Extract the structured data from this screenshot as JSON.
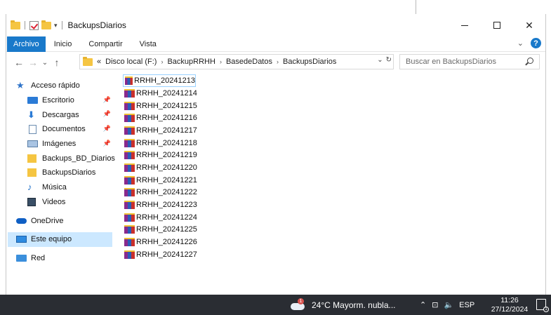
{
  "window": {
    "title": "BackupsDiarios"
  },
  "ribbon": {
    "tabs": [
      {
        "label": "Archivo",
        "active": true
      },
      {
        "label": "Inicio",
        "active": false
      },
      {
        "label": "Compartir",
        "active": false
      },
      {
        "label": "Vista",
        "active": false
      }
    ],
    "help_label": "?"
  },
  "address": {
    "overflow": "«",
    "crumbs": [
      "Disco local (F:)",
      "BackupRRHH",
      "BasedeDatos",
      "BackupsDiarios"
    ]
  },
  "search": {
    "placeholder": "Buscar en BackupsDiarios"
  },
  "sidebar": {
    "items": [
      {
        "label": "Acceso rápido",
        "icon": "star-icon",
        "pinned": false
      },
      {
        "label": "Escritorio",
        "icon": "desktop-icon",
        "pinned": true
      },
      {
        "label": "Descargas",
        "icon": "download-icon",
        "pinned": true
      },
      {
        "label": "Documentos",
        "icon": "documents-icon",
        "pinned": true
      },
      {
        "label": "Imágenes",
        "icon": "pictures-icon",
        "pinned": true
      },
      {
        "label": "Backups_BD_Diarios",
        "icon": "folder-icon",
        "pinned": false
      },
      {
        "label": "BackupsDiarios",
        "icon": "folder-icon",
        "pinned": false
      },
      {
        "label": "Música",
        "icon": "music-icon",
        "pinned": false
      },
      {
        "label": "Videos",
        "icon": "videos-icon",
        "pinned": false
      },
      {
        "label": "OneDrive",
        "icon": "onedrive-icon",
        "pinned": false
      },
      {
        "label": "Este equipo",
        "icon": "this-pc-icon",
        "pinned": false
      },
      {
        "label": "Red",
        "icon": "network-icon",
        "pinned": false
      }
    ]
  },
  "files": [
    "RRHH_20241213",
    "RRHH_20241214",
    "RRHH_20241215",
    "RRHH_20241216",
    "RRHH_20241217",
    "RRHH_20241218",
    "RRHH_20241219",
    "RRHH_20241220",
    "RRHH_20241221",
    "RRHH_20241222",
    "RRHH_20241223",
    "RRHH_20241224",
    "RRHH_20241225",
    "RRHH_20241226",
    "RRHH_20241227"
  ],
  "taskbar": {
    "weather": "24°C  Mayorm. nubla...",
    "weather_badge": "1",
    "language": "ESP",
    "time": "11:26",
    "date": "27/12/2024",
    "notification_count": "1"
  }
}
